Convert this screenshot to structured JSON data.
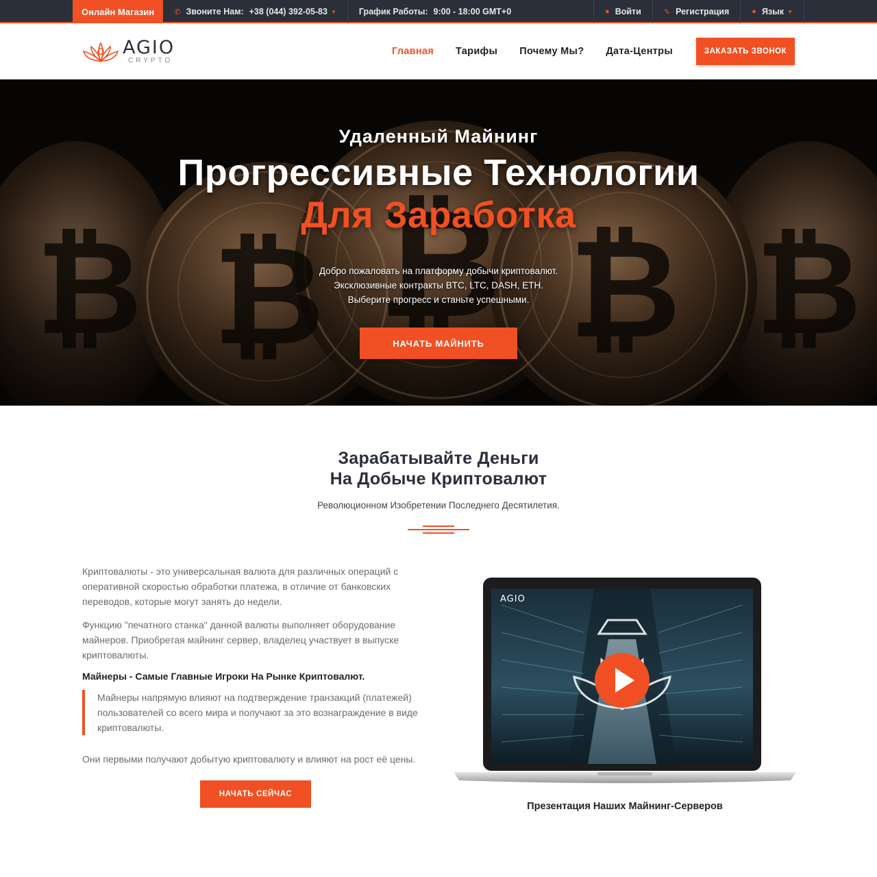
{
  "topbar": {
    "shop_label": "Онлайн Магазин",
    "phone_label": "Звоните Нам:",
    "phone_number": "+38 (044) 392-05-83",
    "hours_label": "График Работы:",
    "hours_value": "9:00 - 18:00 GMT+0",
    "login_label": "Войти",
    "register_label": "Регистрация",
    "language_label": "Язык"
  },
  "header": {
    "logo_main": "AGIO",
    "logo_sub": "CRYPTO",
    "nav": [
      "Главная",
      "Тарифы",
      "Почему Мы?",
      "Дата-Центры"
    ],
    "call_button": "ЗАКАЗАТЬ ЗВОНОК"
  },
  "hero": {
    "eyebrow": "Удаленный Майнинг",
    "title_line1": "Прогрессивные Технологии",
    "title_line2": "Для Заработка",
    "desc_line1": "Добро пожаловать на платформу добычи криптовалют.",
    "desc_line2": "Эксклюзивные контракты BTC, LTC, DASH, ETH.",
    "desc_line3": "Выберите прогресс и станьте успешными.",
    "cta": "НАЧАТЬ МАЙНИТЬ"
  },
  "about": {
    "heading_line1": "Зарабатывайте Деньги",
    "heading_line2": "На Добыче Криптовалют",
    "subheading": "Революционном Изобретении Последнего Десятилетия.",
    "para1": "Криптовалюты - это универсальная валюта для различных операций с оперативной скоростью обработки платежа, в отличие от банковских переводов, которые могут занять до недели.",
    "para2": "Функцию \"печатного станка\" данной валюты выполняет оборудование майнеров. Приобретая майнинг сервер, владелец участвует в выпуске криптовалюты.",
    "bold_heading": "Майнеры - Самые Главные Игроки На Рынке Криптовалют.",
    "quote": "Майнеры напрямую влияют на подтверждение транзакций (платежей) пользователей со всего мира и получают за это вознаграждение в виде криптовалюты.",
    "para3": "Они первыми получают добытую криптовалюту и влияют на рост её цены.",
    "start_button": "НАЧАТЬ СЕЙЧАС",
    "video_logo": "AGIO",
    "video_caption": "Презентация Наших Майнинг-Серверов"
  },
  "colors": {
    "accent": "#f05023",
    "dark": "#2b2f3a"
  }
}
